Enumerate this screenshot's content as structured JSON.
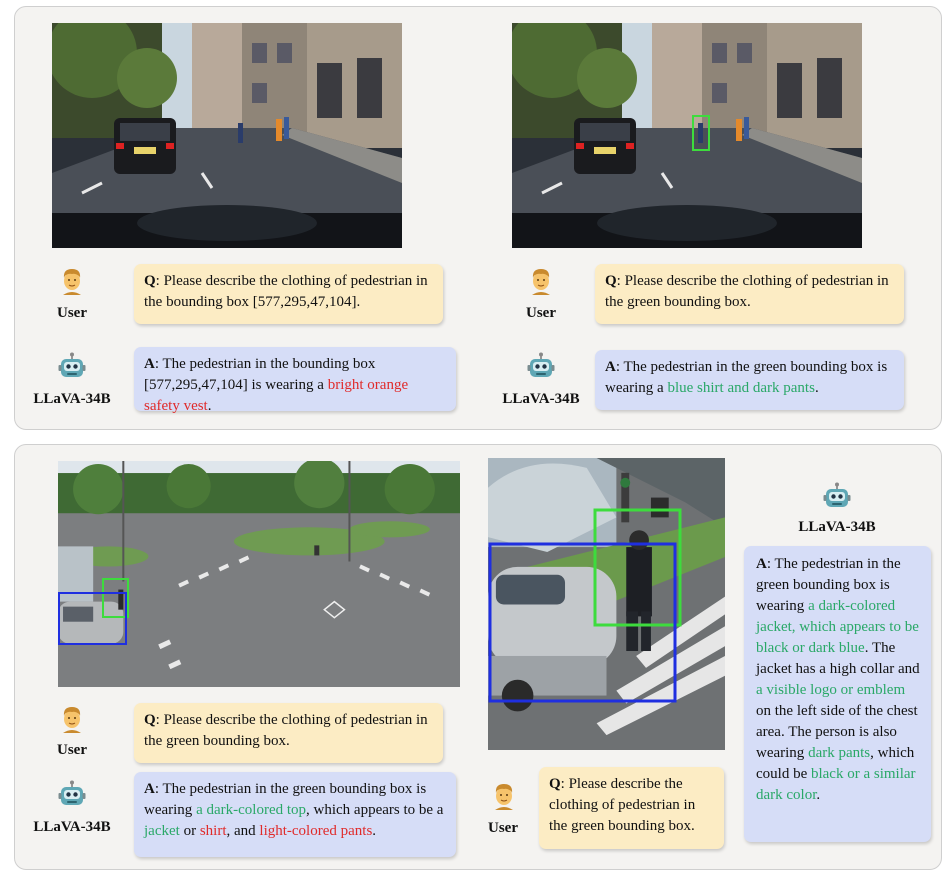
{
  "labels": {
    "user": "User",
    "model": "LLaVA-34B",
    "q_prefix": "Q",
    "a_prefix": "A"
  },
  "ex1": {
    "question": ": Please describe the clothing of pedestrian in the bounding box [577,295,47,104].",
    "answer_pre": ": The pedestrian in the bounding box [577,295,47,104] is wearing a ",
    "answer_hl": "bright orange safety vest",
    "answer_post": "."
  },
  "ex2": {
    "question": ": Please describe the clothing of pedestrian in the green bounding box.",
    "answer_pre": ": The pedestrian in the green bounding box is wearing a ",
    "answer_hl": "blue shirt and dark pants",
    "answer_post": "."
  },
  "ex3": {
    "question": ": Please describe the clothing of pedestrian in the green bounding box.",
    "a1": ": The pedestrian in the green bounding box is wearing ",
    "a2": "a dark-colored top",
    "a3": ", which appears to be a ",
    "a4": "jacket",
    "a5": " or ",
    "a6": "shirt",
    "a7": ", and ",
    "a8": "light-colored pants",
    "a9": "."
  },
  "ex4": {
    "question": ": Please describe the clothing of pedestrian in the green bounding box.",
    "a1": ": The pedestrian in the green bounding box is wearing ",
    "a2": "a dark-colored jacket, which appears to be black or dark blue",
    "a3": ". The jacket has a high collar and ",
    "a4": "a visible logo or emblem",
    "a5": " on the left side of the chest area. The person is also wearing ",
    "a6": "dark pants",
    "a7": ", which could be ",
    "a8": "black or a similar dark color",
    "a9": "."
  },
  "colors": {
    "highlight_green": "#2aa868",
    "highlight_red": "#e02b2b",
    "question_bg": "#fcecc4",
    "answer_bg": "#d6ddf7",
    "box_green": "#3ddc3d",
    "box_blue": "#1f2fe0"
  }
}
